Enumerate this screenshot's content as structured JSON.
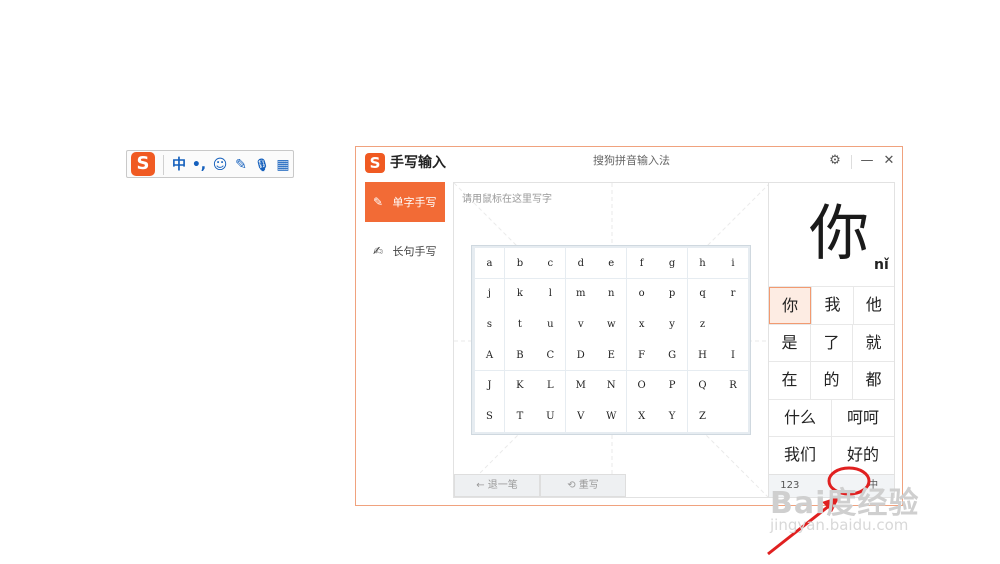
{
  "toolbar": {
    "logo": "S",
    "items": [
      {
        "icon": "chinese-mode",
        "glyph": "中"
      },
      {
        "icon": "punctuation-icon",
        "glyph": "•,"
      },
      {
        "icon": "emoji-icon",
        "glyph": "☺"
      },
      {
        "icon": "pencil-icon",
        "glyph": "✎"
      },
      {
        "icon": "microphone-icon",
        "glyph": "🎙"
      },
      {
        "icon": "toolbox-icon",
        "glyph": "▦"
      }
    ],
    "accent": "#1560bd"
  },
  "window": {
    "logo": "S",
    "title": "手写输入",
    "subtitle": "搜狗拼音输入法",
    "settings_glyph": "⚙",
    "minimize_glyph": "—",
    "close_glyph": "✕",
    "accent": "#f26b36"
  },
  "modes": {
    "single": {
      "label": "单字手写",
      "icon": "edit-icon",
      "glyph": "✎"
    },
    "sentence": {
      "label": "长句手写",
      "icon": "sentence-icon",
      "glyph": "✍"
    }
  },
  "canvas": {
    "hint": "请用鼠标在这里写字"
  },
  "keyboard": {
    "rows": [
      [
        "a",
        "b",
        "c",
        "d",
        "e",
        "f",
        "g",
        "h",
        "i"
      ],
      [
        "j",
        "k",
        "l",
        "m",
        "n",
        "o",
        "p",
        "q",
        "r"
      ],
      [
        "s",
        "t",
        "u",
        "v",
        "w",
        "x",
        "y",
        "z",
        ""
      ],
      [
        "A",
        "B",
        "C",
        "D",
        "E",
        "F",
        "G",
        "H",
        "I"
      ],
      [
        "J",
        "K",
        "L",
        "M",
        "N",
        "O",
        "P",
        "Q",
        "R"
      ],
      [
        "S",
        "T",
        "U",
        "V",
        "W",
        "X",
        "Y",
        "Z",
        ""
      ]
    ]
  },
  "buttons": {
    "undo": "← 退一笔",
    "rewrite": "⟲ 重写"
  },
  "result": {
    "char": "你",
    "pinyin": "nǐ",
    "candidates": [
      [
        "你",
        "我",
        "他"
      ],
      [
        "是",
        "了",
        "就"
      ],
      [
        "在",
        "的",
        "都"
      ],
      [
        "什么",
        "呵呵"
      ],
      [
        "我们",
        "好的"
      ]
    ],
    "tools": [
      "123",
      "",
      "中"
    ]
  },
  "watermark": {
    "main": "Bai度经验",
    "sub": "jingyan.baidu.com"
  }
}
